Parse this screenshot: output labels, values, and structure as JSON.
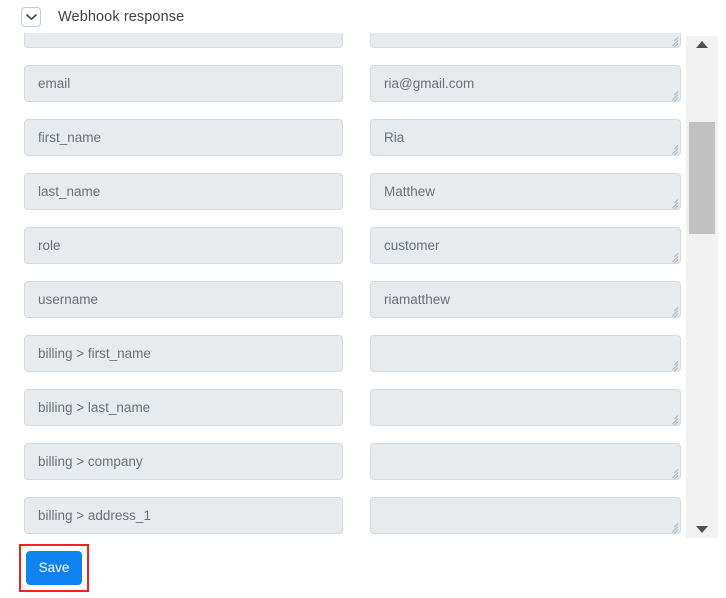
{
  "header": {
    "title": "Webhook response",
    "collapse_icon": "chevron-down-icon"
  },
  "mapping_rows": [
    {
      "key": "",
      "value": ""
    },
    {
      "key": "email",
      "value": "ria@gmail.com"
    },
    {
      "key": "first_name",
      "value": "Ria"
    },
    {
      "key": "last_name",
      "value": "Matthew"
    },
    {
      "key": "role",
      "value": "customer"
    },
    {
      "key": "username",
      "value": "riamatthew"
    },
    {
      "key": "billing > first_name",
      "value": ""
    },
    {
      "key": "billing > last_name",
      "value": ""
    },
    {
      "key": "billing > company",
      "value": ""
    },
    {
      "key": "billing > address_1",
      "value": ""
    }
  ],
  "scrollbar": {
    "up_icon": "caret-up-icon",
    "down_icon": "caret-down-icon"
  },
  "footer": {
    "save_label": "Save"
  },
  "colors": {
    "accent_button": "#0f82f2",
    "highlight_outline": "#f41f1f",
    "field_background": "#e7ebee",
    "field_border": "#d2dae1",
    "scrollbar_thumb": "#c1c1c1"
  }
}
